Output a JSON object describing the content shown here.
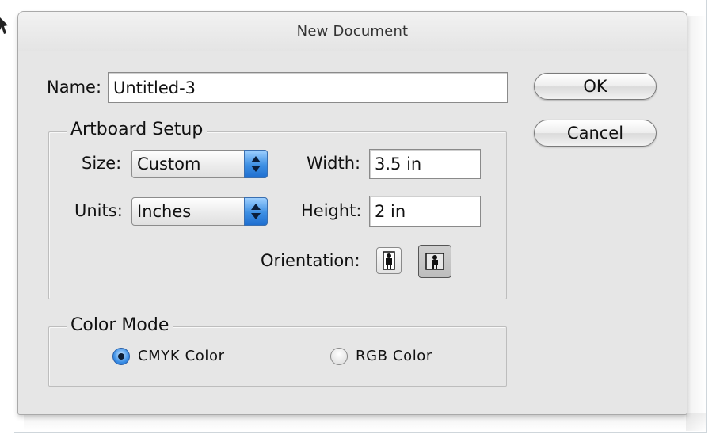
{
  "window": {
    "title": "New Document"
  },
  "name": {
    "label": "Name:",
    "value": "Untitled-3"
  },
  "buttons": {
    "ok": "OK",
    "cancel": "Cancel"
  },
  "artboard": {
    "title": "Artboard Setup",
    "size_label": "Size:",
    "size_value": "Custom",
    "units_label": "Units:",
    "units_value": "Inches",
    "width_label": "Width:",
    "width_value": "3.5 in",
    "height_label": "Height:",
    "height_value": "2 in",
    "orientation_label": "Orientation:",
    "orientation_selected": "landscape"
  },
  "color_mode": {
    "title": "Color Mode",
    "options": [
      {
        "label": "CMYK Color",
        "selected": true
      },
      {
        "label": "RGB Color",
        "selected": false
      }
    ]
  },
  "colors": {
    "accent": "#3b8fe6",
    "dialog_bg": "#e6e6e6"
  }
}
